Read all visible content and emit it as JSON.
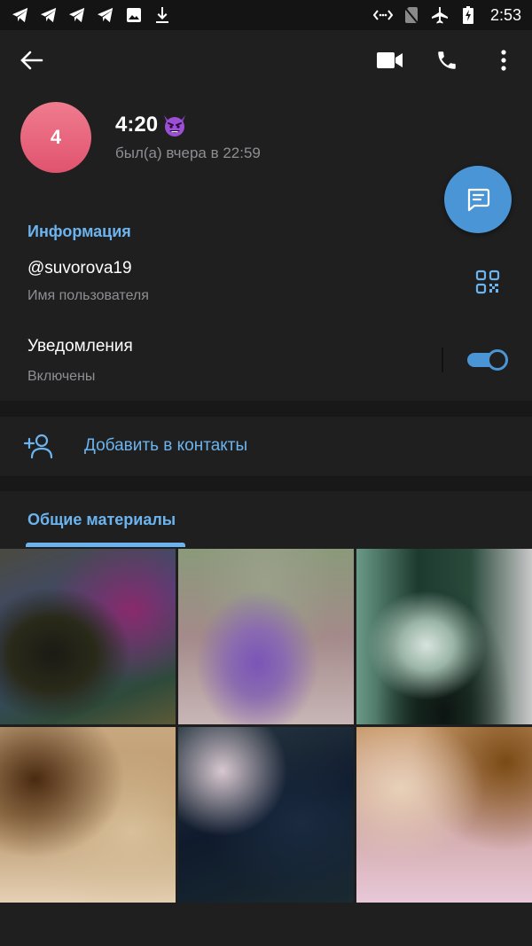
{
  "status_bar": {
    "time": "2:53",
    "left_icons": [
      "telegram-icon",
      "telegram-icon",
      "telegram-icon",
      "telegram-icon",
      "image-icon",
      "download-icon"
    ],
    "right_icons": [
      "data-saver-icon",
      "no-sim-icon",
      "airplane-icon",
      "battery-charging-icon"
    ]
  },
  "header": {
    "actions": [
      "back-arrow-icon",
      "video-call-icon",
      "phone-icon",
      "more-vertical-icon"
    ]
  },
  "profile": {
    "avatar_letter": "4",
    "name": "4:20",
    "name_emoji": "smiling-devil-emoji",
    "last_seen": "был(а) вчера в 22:59",
    "avatar_color": "#e8607a"
  },
  "info": {
    "title": "Информация",
    "username": "@suvorova19",
    "username_label": "Имя пользователя",
    "notifications_label": "Уведомления",
    "notifications_state": "Включены",
    "notifications_on": true
  },
  "add_contact": {
    "label": "Добавить в контакты"
  },
  "shared_media": {
    "tab_label": "Общие материалы",
    "items_count_visible": 6
  },
  "colors": {
    "accent": "#6cb4ef",
    "fab": "#4a95d6",
    "background": "#1f1f1f",
    "separator": "#181818"
  }
}
